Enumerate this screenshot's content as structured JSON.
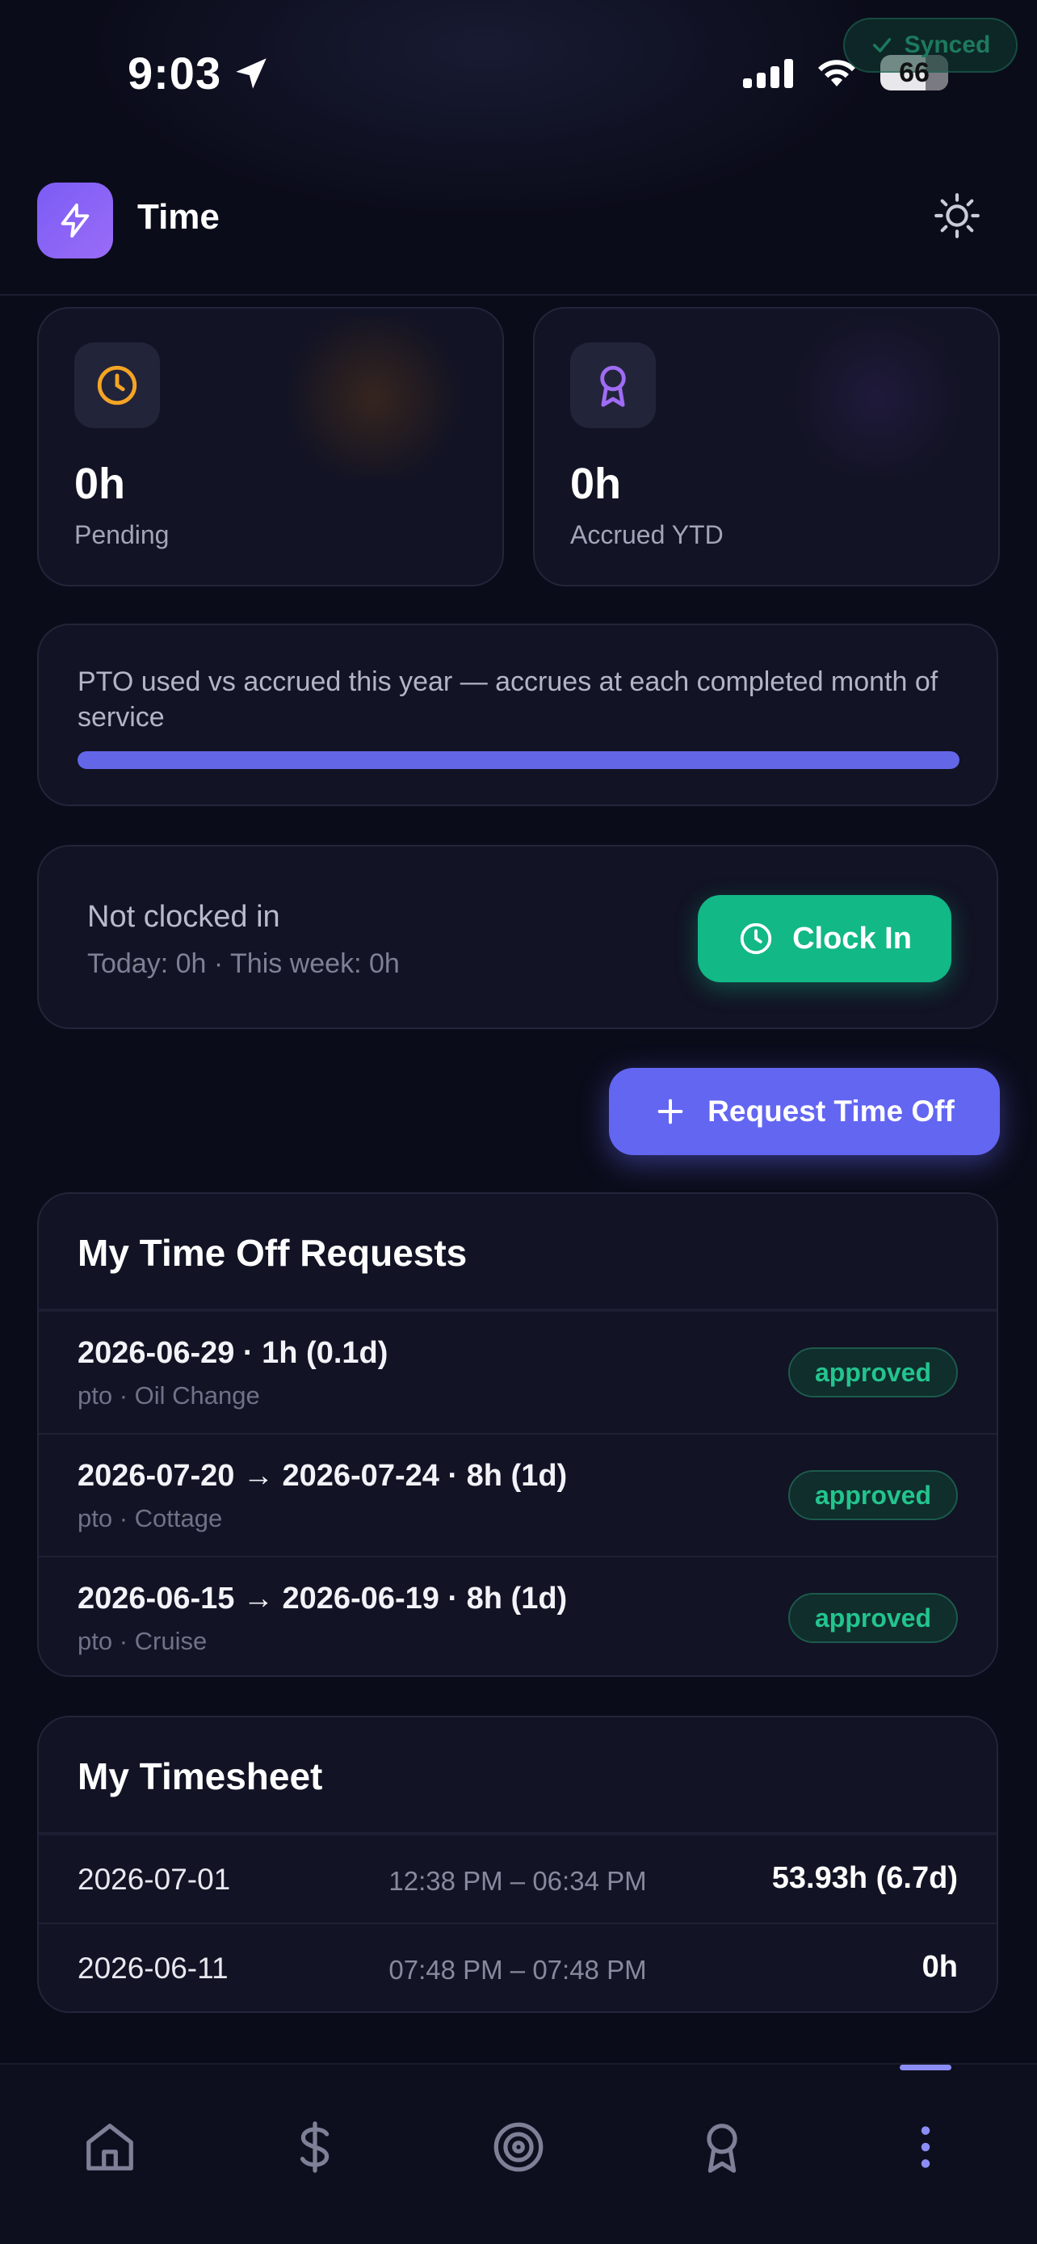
{
  "status_bar": {
    "time": "9:03",
    "battery": "66"
  },
  "sync": {
    "label": "Synced"
  },
  "header": {
    "title": "Time"
  },
  "stats": [
    {
      "value": "0h",
      "label": "Pending",
      "icon": "clock-icon",
      "color": "#f5a524"
    },
    {
      "value": "0h",
      "label": "Accrued YTD",
      "icon": "award-icon",
      "color": "#a06cf5"
    }
  ],
  "pto": {
    "text": "PTO used vs accrued this year — accrues at each completed month of service",
    "progress": 1.0
  },
  "clock": {
    "status": "Not clocked in",
    "summary": "Today: 0h · This week: 0h",
    "button_label": "Clock In"
  },
  "request_button": {
    "label": "Request Time Off"
  },
  "requests": {
    "title": "My Time Off Requests",
    "items": [
      {
        "title": "2026-06-29 · 1h (0.1d)",
        "subtitle": "pto · Oil Change",
        "status": "approved"
      },
      {
        "title": "2026-07-20 → 2026-07-24 · 8h (1d)",
        "subtitle": "pto · Cottage",
        "status": "approved"
      },
      {
        "title": "2026-06-15 → 2026-06-19 · 8h (1d)",
        "subtitle": "pto · Cruise",
        "status": "approved"
      }
    ]
  },
  "timesheet": {
    "title": "My Timesheet",
    "rows": [
      {
        "date": "2026-07-01",
        "range": "12:38 PM – 06:34 PM",
        "hours": "53.93h (6.7d)"
      },
      {
        "date": "2026-06-11",
        "range": "07:48 PM – 07:48 PM",
        "hours": "0h"
      }
    ]
  },
  "nav": {
    "items": [
      "home-icon",
      "dollar-icon",
      "target-icon",
      "award-icon",
      "more-vertical-icon"
    ],
    "active_index": 4
  },
  "colors": {
    "accent": "#6366f1",
    "success": "#12b886",
    "background": "#0b0c1a"
  }
}
